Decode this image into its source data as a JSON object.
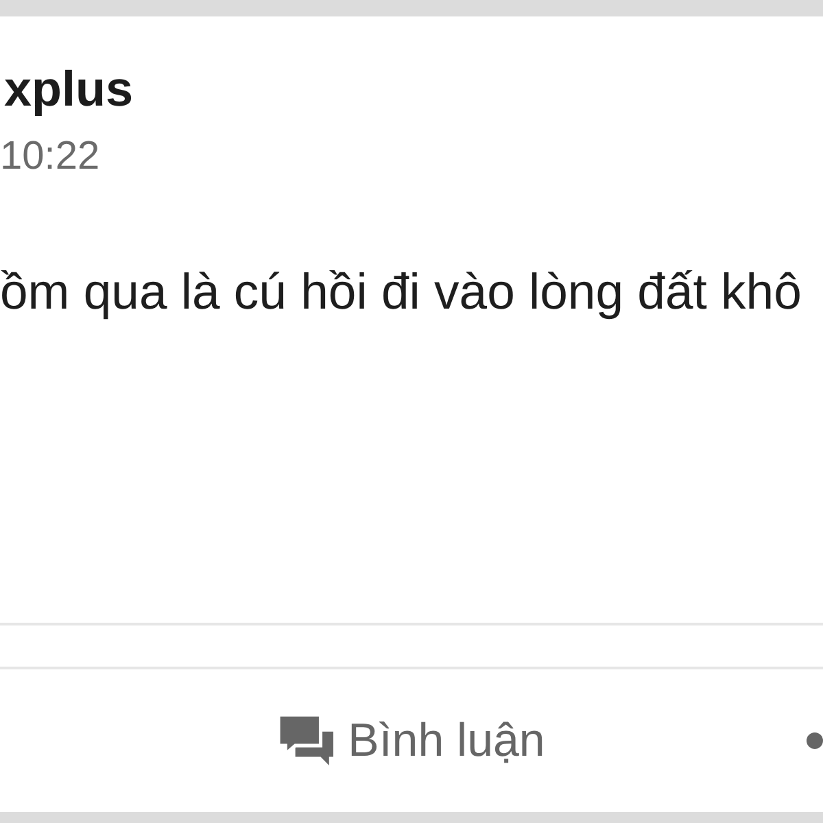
{
  "author": {
    "name": "xplus",
    "time": "10:22"
  },
  "post": {
    "text": "ồm qua là cú hồi đi vào lòng đất khô"
  },
  "actions": [
    {
      "kind": "comment",
      "label": "Bình luận"
    },
    {
      "kind": "dot"
    }
  ]
}
